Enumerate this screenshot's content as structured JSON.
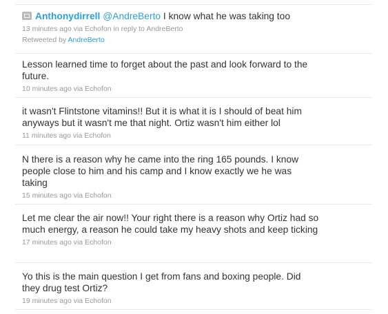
{
  "tweets": [
    {
      "username": "Anthonydirrell",
      "mention": "@AndreBerto",
      "text": " I know what he was taking too",
      "meta": "13 minutes ago via Echofon in reply to AndreBerto",
      "retweeted_prefix": "Retweeted by ",
      "retweeted_by": "AndreBerto"
    },
    {
      "text": "Lesson learned time to forget about the past and look forward to the future.",
      "meta": "10 minutes ago via Echofon"
    },
    {
      "text": "it wasn't Flintstone vitamins!! But it is what it is I should of beat him anyways but it wasn't me that night. Ortiz wasn't him either lol",
      "meta": "11 minutes ago via Echofon"
    },
    {
      "text": "N there is a reason why he came into the ring 165 pounds. I know people close to him and his camp and I know exactly we he was taking",
      "meta": "15 minutes ago via Echofon"
    },
    {
      "text": "Let me clear the air now!! Your right there is a reason why Ortiz had so much energy, a reason he could take my heavy shots and keep ticking",
      "meta": "17 minutes ago via Echofon"
    },
    {
      "text": "Yo this is the main question I get from fans and boxing people. Did they drug test Ortiz?",
      "meta": "19 minutes ago via Echofon"
    }
  ]
}
